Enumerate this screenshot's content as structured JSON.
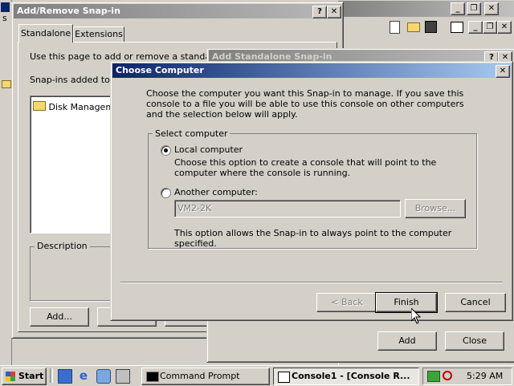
{
  "add_remove": {
    "title": "Add/Remove Snap-in",
    "tabs": [
      "Standalone",
      "Extensions"
    ],
    "intro": "Use this page to add or remove a standalone S",
    "snapins_label": "Snap-ins added to:",
    "list_item": "Disk Managemen",
    "description_label": "Description",
    "add_button": "Add..."
  },
  "add_standalone": {
    "title": "Add Standalone Snap-in",
    "add_button": "Add",
    "close_button": "Close"
  },
  "choose_computer": {
    "title": "Choose Computer",
    "intro": "Choose the computer you want this Snap-in to manage. If you save this console to a file you will be able to use this console on other computers and the selection below will apply.",
    "group_label": "Select computer",
    "local_label": "Local computer",
    "local_desc": "Choose this option to create a console that will point to the computer where the console is running.",
    "local_selected": true,
    "another_label": "Another computer:",
    "computer_value": "VM2-2K",
    "browse_button": "Browse...",
    "another_desc": "This option allows the Snap-in to always point to the computer specified.",
    "back_button": "< Back",
    "finish_button": "Finish",
    "cancel_button": "Cancel"
  },
  "background_window": {
    "title_fragment": "s"
  },
  "taskbar": {
    "start_label": "Start",
    "tasks": [
      "Command Prompt",
      "Console1 - [Console R..."
    ],
    "clock": "5:29 AM"
  },
  "colors": {
    "active_title_start": "#0a246a",
    "active_title_end": "#a6caf0",
    "face": "#d4d0c8"
  }
}
